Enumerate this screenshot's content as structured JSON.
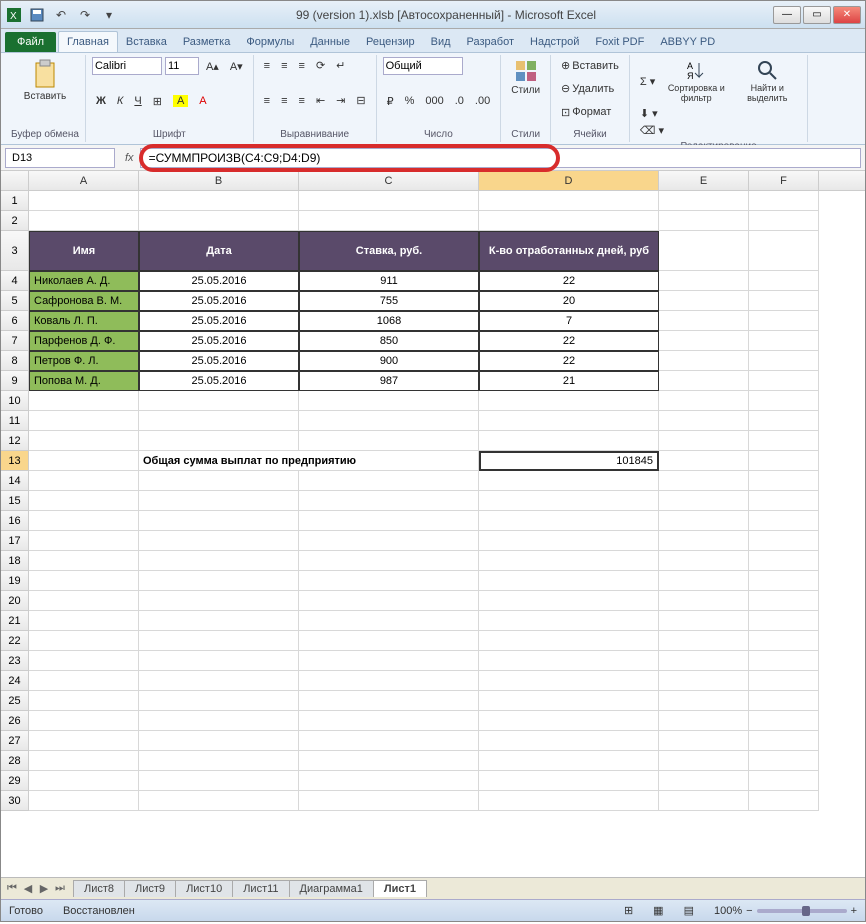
{
  "window": {
    "title": "99 (version 1).xlsb [Автосохраненный] - Microsoft Excel"
  },
  "ribbon": {
    "file": "Файл",
    "tabs": [
      "Главная",
      "Вставка",
      "Разметка",
      "Формулы",
      "Данные",
      "Рецензир",
      "Вид",
      "Разработ",
      "Надстрой",
      "Foxit PDF",
      "ABBYY PD"
    ],
    "active_tab": 0,
    "clipboard": {
      "paste": "Вставить",
      "label": "Буфер обмена"
    },
    "font": {
      "name": "Calibri",
      "size": "11",
      "label": "Шрифт",
      "bold": "Ж",
      "italic": "К",
      "underline": "Ч"
    },
    "alignment": {
      "label": "Выравнивание"
    },
    "number": {
      "format": "Общий",
      "label": "Число"
    },
    "styles": {
      "label": "Стили",
      "btn": "Стили"
    },
    "cells": {
      "insert": "Вставить",
      "delete": "Удалить",
      "format": "Формат",
      "label": "Ячейки"
    },
    "editing": {
      "sort": "Сортировка и фильтр",
      "find": "Найти и выделить",
      "label": "Редактирование"
    }
  },
  "formula_bar": {
    "name_box": "D13",
    "fx": "fx",
    "formula": "=СУММПРОИЗВ(C4:C9;D4:D9)"
  },
  "columns": [
    "A",
    "B",
    "C",
    "D",
    "E",
    "F"
  ],
  "table": {
    "headers": [
      "Имя",
      "Дата",
      "Ставка, руб.",
      "К-во отработанных дней, руб"
    ],
    "rows": [
      {
        "name": "Николаев А. Д.",
        "date": "25.05.2016",
        "rate": "911",
        "days": "22"
      },
      {
        "name": "Сафронова В. М.",
        "date": "25.05.2016",
        "rate": "755",
        "days": "20"
      },
      {
        "name": "Коваль Л. П.",
        "date": "25.05.2016",
        "rate": "1068",
        "days": "7"
      },
      {
        "name": "Парфенов Д. Ф.",
        "date": "25.05.2016",
        "rate": "850",
        "days": "22"
      },
      {
        "name": "Петров Ф. Л.",
        "date": "25.05.2016",
        "rate": "900",
        "days": "22"
      },
      {
        "name": "Попова М. Д.",
        "date": "25.05.2016",
        "rate": "987",
        "days": "21"
      }
    ],
    "summary_label": "Общая сумма выплат по предприятию",
    "summary_value": "101845"
  },
  "sheets": [
    "Лист8",
    "Лист9",
    "Лист10",
    "Лист11",
    "Диаграмма1",
    "Лист1"
  ],
  "active_sheet": 5,
  "status": {
    "ready": "Готово",
    "recovered": "Восстановлен",
    "zoom": "100%"
  }
}
